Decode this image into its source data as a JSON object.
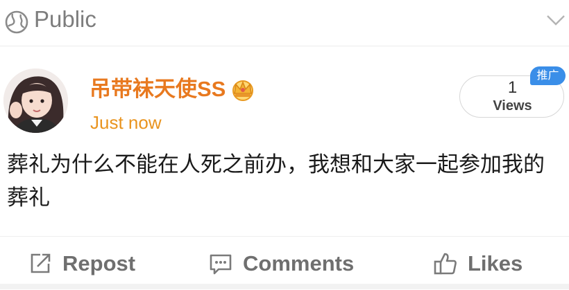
{
  "header": {
    "visibility_icon": "globe-icon",
    "visibility_label": "Public",
    "menu_icon": "chevron-down-icon"
  },
  "post": {
    "author": {
      "avatar": "avatar",
      "name": "吊带袜天使SS",
      "badge_icon": "crown-icon"
    },
    "timestamp": "Just now",
    "views": {
      "count": "1",
      "label": "Views",
      "promo_tag": "推广"
    },
    "content": "葬礼为什么不能在人死之前办，我想和大家一起参加我的葬礼"
  },
  "actions": {
    "repost": {
      "icon": "repost-icon",
      "label": "Repost"
    },
    "comments": {
      "icon": "comment-icon",
      "label": "Comments"
    },
    "likes": {
      "icon": "thumbs-up-icon",
      "label": "Likes"
    }
  },
  "colors": {
    "author_name": "#e8791f",
    "timestamp": "#e9941f",
    "promo_tag_bg": "#3a8ee8",
    "action_text": "#6f6f6f"
  }
}
